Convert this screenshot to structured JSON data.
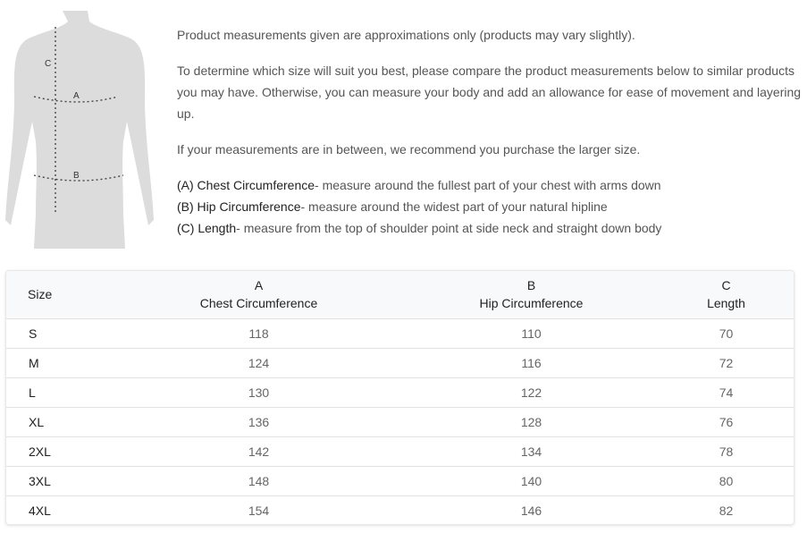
{
  "figure": {
    "labels": {
      "a": "A",
      "b": "B",
      "c": "C"
    }
  },
  "intro": {
    "p1": "Product measurements given are approximations only (products may vary slightly).",
    "p2": "To determine which size will suit you best, please compare the product measurements below to similar products you may have. Otherwise, you can measure your body and add an allowance for ease of movement and layering up.",
    "p3": "If your measurements are in between, we recommend you purchase the larger size.",
    "definitions": [
      {
        "term": "(A) Chest Circumference",
        "desc": "- measure around the fullest part of your chest with arms down"
      },
      {
        "term": "(B) Hip Circumference",
        "desc": "- measure around the widest part of your natural hipline"
      },
      {
        "term": "(C) Length",
        "desc": "- measure from the top of shoulder point at side neck and straight down body"
      }
    ]
  },
  "table": {
    "headers": {
      "size": "Size",
      "a_letter": "A",
      "a_label": "Chest Circumference",
      "b_letter": "B",
      "b_label": "Hip Circumference",
      "c_letter": "C",
      "c_label": "Length"
    },
    "rows": [
      {
        "size": "S",
        "a": "118",
        "b": "110",
        "c": "70"
      },
      {
        "size": "M",
        "a": "124",
        "b": "116",
        "c": "72"
      },
      {
        "size": "L",
        "a": "130",
        "b": "122",
        "c": "74"
      },
      {
        "size": "XL",
        "a": "136",
        "b": "128",
        "c": "76"
      },
      {
        "size": "2XL",
        "a": "142",
        "b": "134",
        "c": "78"
      },
      {
        "size": "3XL",
        "a": "148",
        "b": "140",
        "c": "80"
      },
      {
        "size": "4XL",
        "a": "154",
        "b": "146",
        "c": "82"
      }
    ]
  }
}
